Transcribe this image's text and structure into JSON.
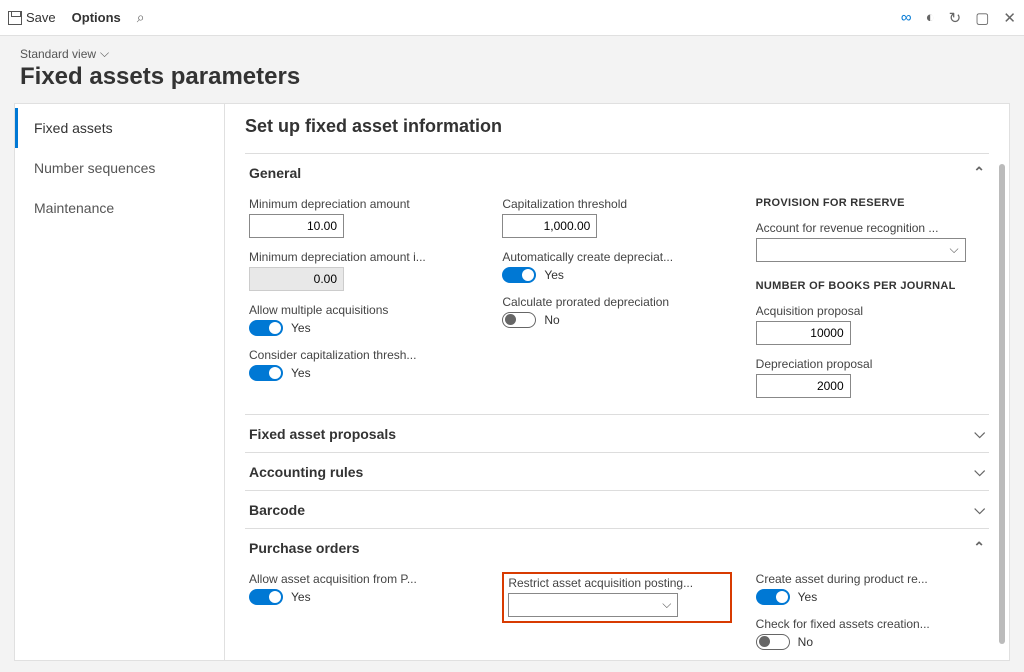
{
  "topbar": {
    "save_label": "Save",
    "options_label": "Options"
  },
  "header": {
    "view_label": "Standard view",
    "page_title": "Fixed assets parameters"
  },
  "sidebar": {
    "items": [
      {
        "label": "Fixed assets",
        "active": true
      },
      {
        "label": "Number sequences",
        "active": false
      },
      {
        "label": "Maintenance",
        "active": false
      }
    ]
  },
  "content": {
    "title": "Set up fixed asset information",
    "sections": {
      "general": {
        "title": "General",
        "col1": {
          "min_depr_label": "Minimum depreciation amount",
          "min_depr_value": "10.00",
          "min_depr_in_label": "Minimum depreciation amount i...",
          "min_depr_in_value": "0.00",
          "allow_multi_label": "Allow multiple acquisitions",
          "allow_multi_value": "Yes",
          "consider_cap_label": "Consider capitalization thresh...",
          "consider_cap_value": "Yes"
        },
        "col2": {
          "cap_thresh_label": "Capitalization threshold",
          "cap_thresh_value": "1,000.00",
          "auto_create_label": "Automatically create depreciat...",
          "auto_create_value": "Yes",
          "calc_prorated_label": "Calculate prorated depreciation",
          "calc_prorated_value": "No"
        },
        "col3": {
          "provision_title": "PROVISION FOR RESERVE",
          "account_rev_label": "Account for revenue recognition ...",
          "account_rev_value": "",
          "num_books_title": "NUMBER OF BOOKS PER JOURNAL",
          "acq_proposal_label": "Acquisition proposal",
          "acq_proposal_value": "10000",
          "depr_proposal_label": "Depreciation proposal",
          "depr_proposal_value": "2000"
        }
      },
      "fixed_asset_proposals": {
        "title": "Fixed asset proposals"
      },
      "accounting_rules": {
        "title": "Accounting rules"
      },
      "barcode": {
        "title": "Barcode"
      },
      "purchase_orders": {
        "title": "Purchase orders",
        "col1": {
          "allow_asset_acq_label": "Allow asset acquisition from P...",
          "allow_asset_acq_value": "Yes"
        },
        "col2": {
          "restrict_label": "Restrict asset acquisition posting...",
          "restrict_value": ""
        },
        "col3": {
          "create_asset_label": "Create asset during product re...",
          "create_asset_value": "Yes",
          "check_fixed_label": "Check for fixed assets creation...",
          "check_fixed_value": "No"
        }
      }
    }
  }
}
